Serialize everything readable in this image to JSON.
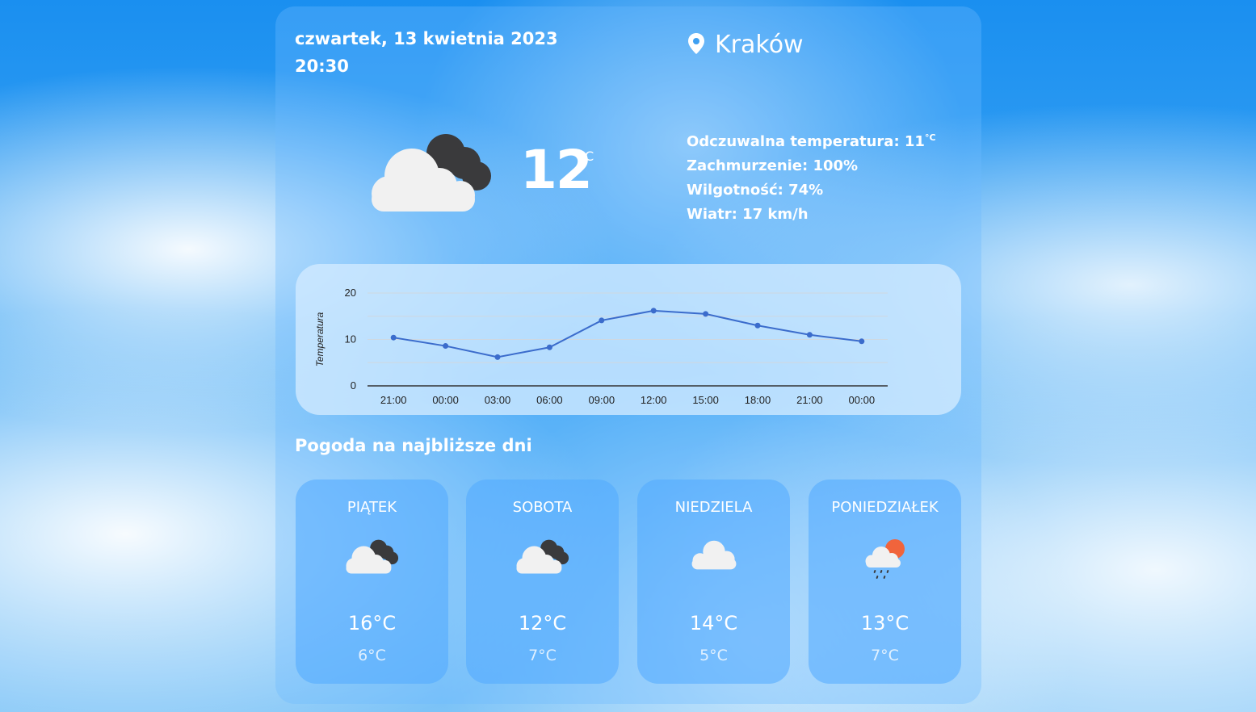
{
  "header": {
    "date": "czwartek, 13 kwietnia 2023",
    "time": "20:30",
    "city": "Kraków",
    "location_icon": "map-pin-icon"
  },
  "current": {
    "temp": "12",
    "unit": "°C",
    "icon": "cloud-dark-icon",
    "feels_like_label": "Odczuwalna temperatura: 11",
    "feels_like_unit": "°C",
    "cloudiness": "Zachmurzenie: 100%",
    "humidity": "Wilgotność: 74%",
    "wind": "Wiatr: 17 km/h"
  },
  "chart_data": {
    "type": "line",
    "ylabel": "Temperatura",
    "xlabel": "",
    "ylim": [
      0,
      20
    ],
    "yticks": [
      "0",
      "10",
      "20"
    ],
    "categories": [
      "21:00",
      "00:00",
      "03:00",
      "06:00",
      "09:00",
      "12:00",
      "15:00",
      "18:00",
      "21:00",
      "00:00"
    ],
    "values": [
      10.4,
      8.6,
      6.2,
      8.3,
      14.1,
      16.2,
      15.5,
      13.0,
      11.0,
      9.6
    ],
    "grid": true,
    "color": "#3b6ccc"
  },
  "forecast": {
    "title": "Pogoda na najbliższe dni",
    "days": [
      {
        "name": "PIĄTEK",
        "hi": "16°C",
        "lo": "6°C",
        "icon": "cloud-dark-icon"
      },
      {
        "name": "SOBOTA",
        "hi": "12°C",
        "lo": "7°C",
        "icon": "cloud-dark-icon"
      },
      {
        "name": "NIEDZIELA",
        "hi": "14°C",
        "lo": "5°C",
        "icon": "cloud-icon"
      },
      {
        "name": "PONIEDZIAŁEK",
        "hi": "13°C",
        "lo": "7°C",
        "icon": "rain-sun-icon"
      }
    ]
  }
}
